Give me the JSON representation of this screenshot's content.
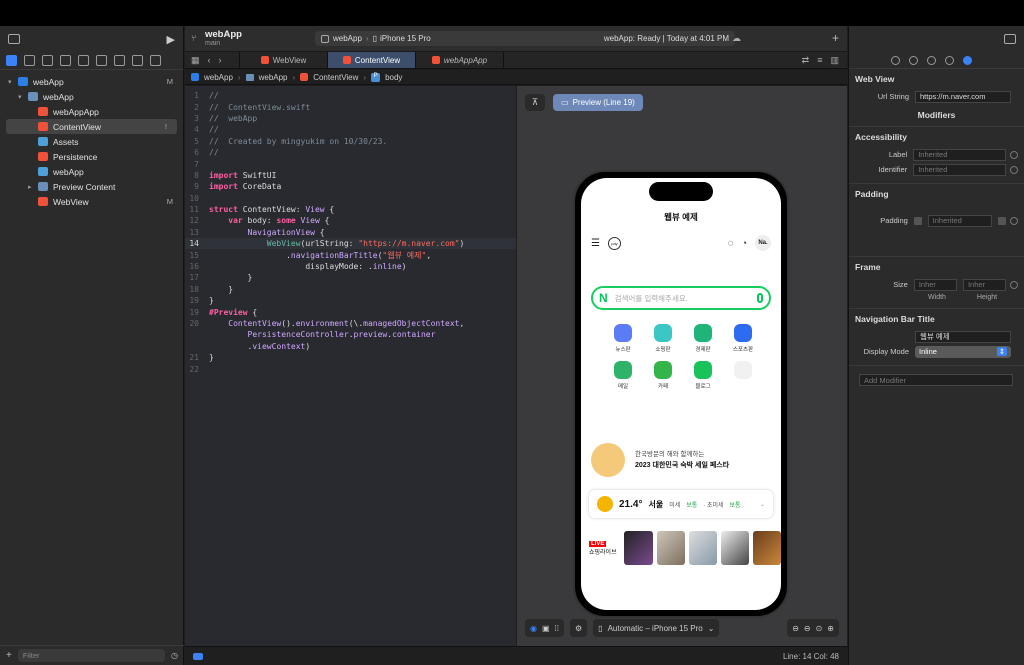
{
  "toolbar": {
    "project": "webApp",
    "branch": "main",
    "scheme_project": "webApp",
    "scheme_device": "iPhone 15 Pro",
    "status": "webApp: Ready | Today at 4:01 PM",
    "tabs": [
      {
        "label": "WebView"
      },
      {
        "label": "ContentView"
      },
      {
        "label": "webAppApp"
      }
    ]
  },
  "navigator": {
    "items": [
      {
        "label": "webApp",
        "badge": "M"
      },
      {
        "label": "webApp",
        "badge": ""
      },
      {
        "label": "webAppApp",
        "badge": ""
      },
      {
        "label": "ContentView",
        "badge": "!"
      },
      {
        "label": "Assets",
        "badge": ""
      },
      {
        "label": "Persistence",
        "badge": ""
      },
      {
        "label": "webApp",
        "badge": ""
      },
      {
        "label": "Preview Content",
        "badge": ""
      },
      {
        "label": "WebView",
        "badge": "M"
      }
    ],
    "filter_placeholder": "Filter"
  },
  "breadcrumb": [
    "webApp",
    "webApp",
    "ContentView",
    "body"
  ],
  "preview": {
    "label": "Preview (Line 19)",
    "device_label": "Automatic – iPhone 15 Pro",
    "nav_title": "웹뷰 예제",
    "top_right": "Na.",
    "search_placeholder": "검색어를 입력해주세요.",
    "icons": [
      {
        "label": "뉴스판",
        "color": "#5b7cf5"
      },
      {
        "label": "쇼핑판",
        "color": "#3cc7c7"
      },
      {
        "label": "경제판",
        "color": "#1fb57a"
      },
      {
        "label": "스포츠판",
        "color": "#2d6cf0"
      },
      {
        "label": "메일",
        "color": "#2fb36b"
      },
      {
        "label": "카페",
        "color": "#33b54a"
      },
      {
        "label": "블로그",
        "color": "#19c35a"
      },
      {
        "label": "",
        "color": "#f1f1f1"
      }
    ],
    "banner_line1": "한국방문의 해와 함께하는",
    "banner_line2": "2023 대한민국 숙박 세일 페스타",
    "weather_temp": "21.4°",
    "weather_city": "서울",
    "weather_fine": "미세",
    "weather_fine_status": "보통",
    "weather_ultra": "· 초미세",
    "weather_ultra_status": "보통",
    "live_badge": "LIVE",
    "live_label": "쇼핑라이브"
  },
  "inspector": {
    "webview_title": "Web View",
    "url_label": "Url String",
    "url_value": "https://m.naver.com",
    "modifiers_title": "Modifiers",
    "accessibility_title": "Accessibility",
    "label_key": "Label",
    "label_ph": "Inherited",
    "identifier_key": "Identifier",
    "identifier_ph": "Inherited",
    "padding_title": "Padding",
    "padding_key": "Padding",
    "padding_value": "Inherited",
    "frame_title": "Frame",
    "size_key": "Size",
    "width_ph": "Inher",
    "height_ph": "Inher",
    "width_label": "Width",
    "height_label": "Height",
    "navbar_title": "Navigation Bar Title",
    "navbar_value": "웹뷰 예제",
    "display_mode_key": "Display Mode",
    "display_mode_value": "Inline",
    "add_modifier": "Add Modifier"
  },
  "status": {
    "line_col": "Line: 14  Col: 48"
  }
}
